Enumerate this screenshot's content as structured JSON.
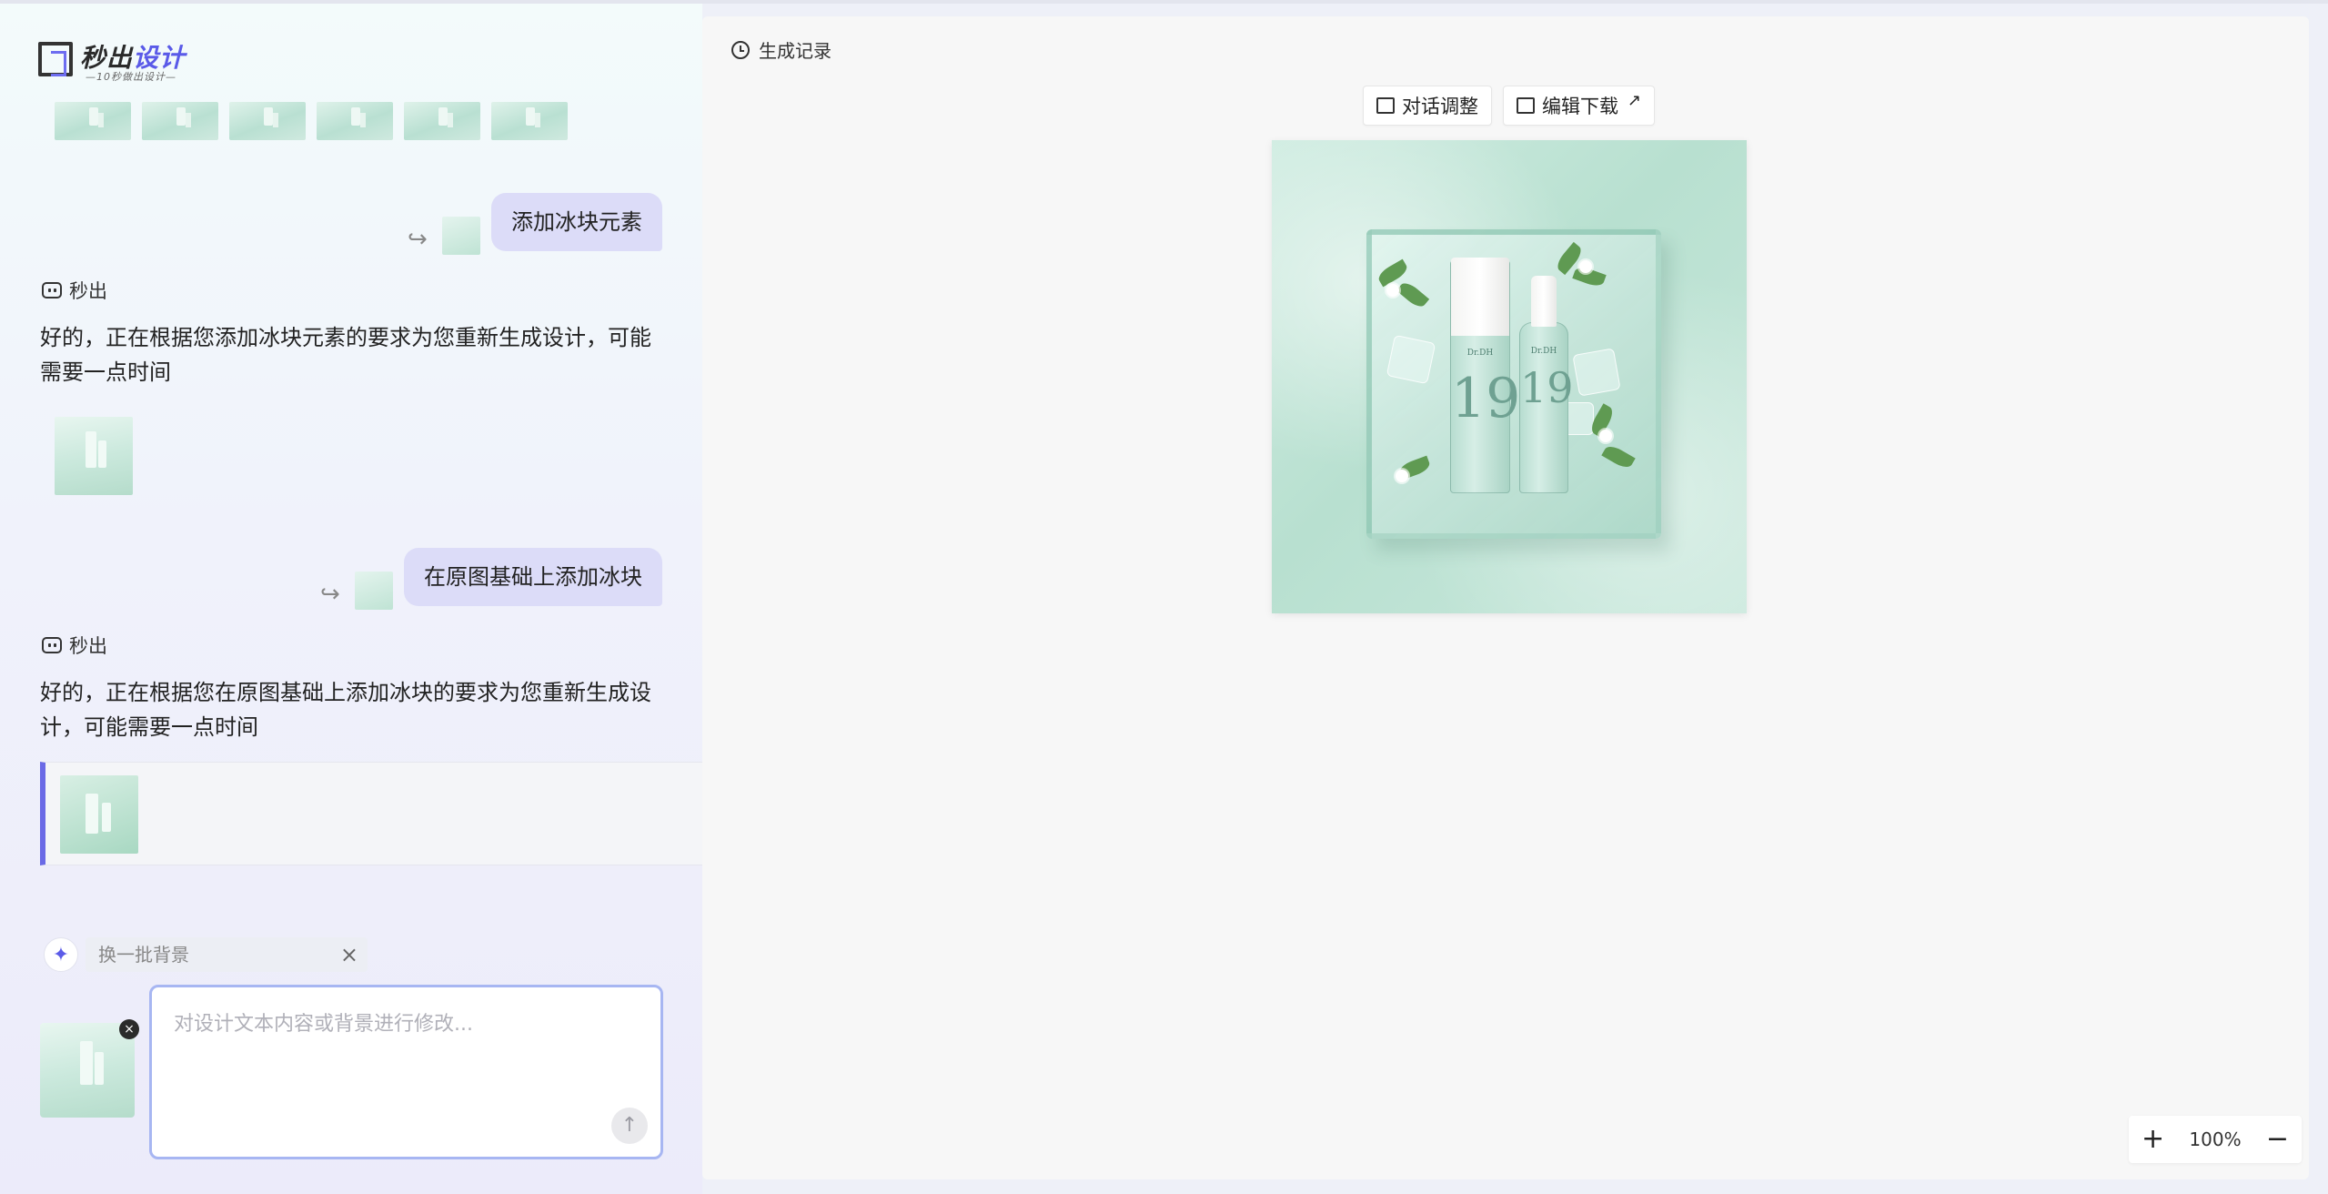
{
  "logo": {
    "name_part1": "秒出",
    "name_part2": "设计",
    "tagline": "—10秒做出设计—"
  },
  "chat": {
    "messages": [
      {
        "role": "user",
        "text": "添加冰块元素"
      },
      {
        "role": "bot",
        "name": "秒出",
        "text": "好的，正在根据您添加冰块元素的要求为您重新生成设计，可能需要一点时间"
      },
      {
        "role": "user",
        "text": "在原图基础上添加冰块"
      },
      {
        "role": "bot",
        "name": "秒出",
        "text": "好的，正在根据您在原图基础上添加冰块的要求为您重新生成设计，可能需要一点时间"
      }
    ],
    "ref_arrow": "↪"
  },
  "composer": {
    "suggestion": "换一批背景",
    "placeholder": "对设计文本内容或背景进行修改...",
    "value": ""
  },
  "canvas_panel": {
    "history_label": "生成记录",
    "chat_adjust_label": "对话调整",
    "edit_download_label": "编辑下载",
    "bottle_brand": "Dr.DH",
    "bottle_number": "19"
  },
  "zoom": {
    "level": "100%",
    "plus": "+",
    "minus": "−"
  },
  "colors": {
    "accent": "#6a6ae6",
    "user_bubble": "#dcdcf8",
    "input_border": "#a7b6f2"
  },
  "icons": [
    "clock-icon",
    "chat-adjust-icon",
    "edit-icon",
    "external-arrow-icon",
    "bot-icon",
    "sparkle-icon",
    "close-icon",
    "send-arrow-icon"
  ]
}
